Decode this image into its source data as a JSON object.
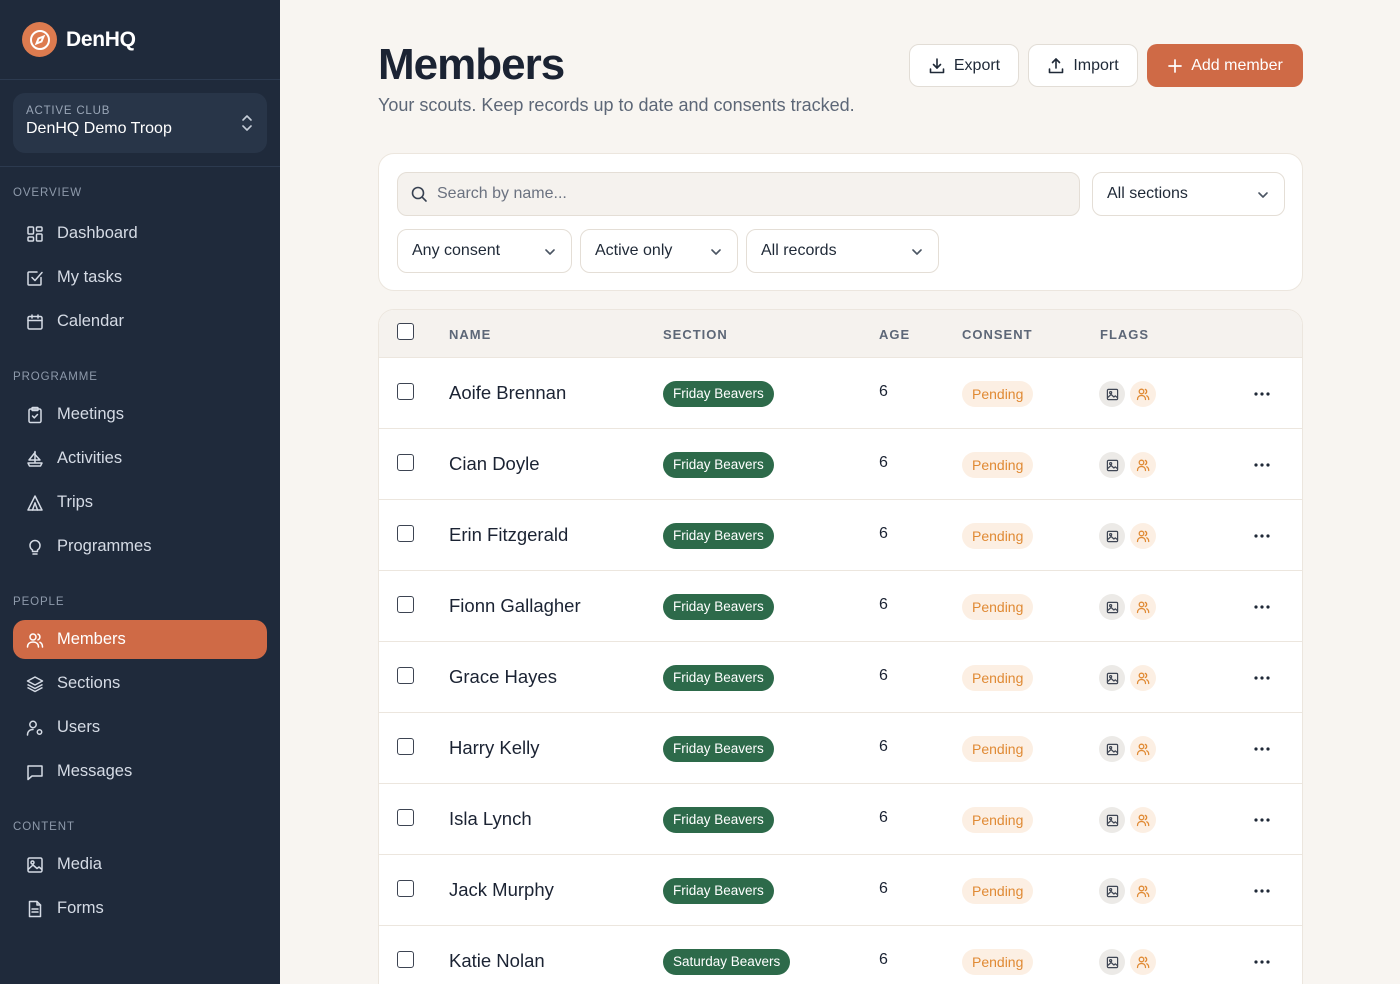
{
  "brand": {
    "name": "DenHQ",
    "accent": "#cf6a46"
  },
  "club": {
    "caption": "ACTIVE CLUB",
    "name": "DenHQ Demo Troop"
  },
  "nav": {
    "overview": {
      "caption": "OVERVIEW",
      "items": [
        {
          "label": "Dashboard",
          "icon": "dashboard-icon"
        },
        {
          "label": "My tasks",
          "icon": "checkbox-icon"
        },
        {
          "label": "Calendar",
          "icon": "calendar-icon"
        }
      ]
    },
    "programme": {
      "caption": "PROGRAMME",
      "items": [
        {
          "label": "Meetings",
          "icon": "clipboard-icon"
        },
        {
          "label": "Activities",
          "icon": "sailboat-icon"
        },
        {
          "label": "Trips",
          "icon": "tent-icon"
        },
        {
          "label": "Programmes",
          "icon": "lightbulb-icon"
        }
      ]
    },
    "people": {
      "caption": "PEOPLE",
      "items": [
        {
          "label": "Members",
          "icon": "users-icon",
          "active": true
        },
        {
          "label": "Sections",
          "icon": "layers-icon"
        },
        {
          "label": "Users",
          "icon": "user-cog-icon"
        },
        {
          "label": "Messages",
          "icon": "message-icon"
        }
      ]
    },
    "content": {
      "caption": "CONTENT",
      "items": [
        {
          "label": "Media",
          "icon": "image-icon"
        },
        {
          "label": "Forms",
          "icon": "document-icon"
        }
      ]
    }
  },
  "header": {
    "title": "Members",
    "subtitle": "Your scouts. Keep records up to date and consents tracked.",
    "export_label": "Export",
    "import_label": "Import",
    "add_label": "Add member"
  },
  "filters": {
    "search_placeholder": "Search by name...",
    "section": "All sections",
    "consent": "Any consent",
    "status": "Active only",
    "records": "All records"
  },
  "table": {
    "columns": [
      "NAME",
      "SECTION",
      "AGE",
      "CONSENT",
      "FLAGS"
    ],
    "rows": [
      {
        "name": "Aoife Brennan",
        "section": "Friday Beavers",
        "age": "6",
        "consent": "Pending"
      },
      {
        "name": "Cian Doyle",
        "section": "Friday Beavers",
        "age": "6",
        "consent": "Pending"
      },
      {
        "name": "Erin Fitzgerald",
        "section": "Friday Beavers",
        "age": "6",
        "consent": "Pending"
      },
      {
        "name": "Fionn Gallagher",
        "section": "Friday Beavers",
        "age": "6",
        "consent": "Pending"
      },
      {
        "name": "Grace Hayes",
        "section": "Friday Beavers",
        "age": "6",
        "consent": "Pending"
      },
      {
        "name": "Harry Kelly",
        "section": "Friday Beavers",
        "age": "6",
        "consent": "Pending"
      },
      {
        "name": "Isla Lynch",
        "section": "Friday Beavers",
        "age": "6",
        "consent": "Pending"
      },
      {
        "name": "Jack Murphy",
        "section": "Friday Beavers",
        "age": "6",
        "consent": "Pending"
      },
      {
        "name": "Katie Nolan",
        "section": "Saturday Beavers",
        "age": "6",
        "consent": "Pending"
      }
    ]
  }
}
